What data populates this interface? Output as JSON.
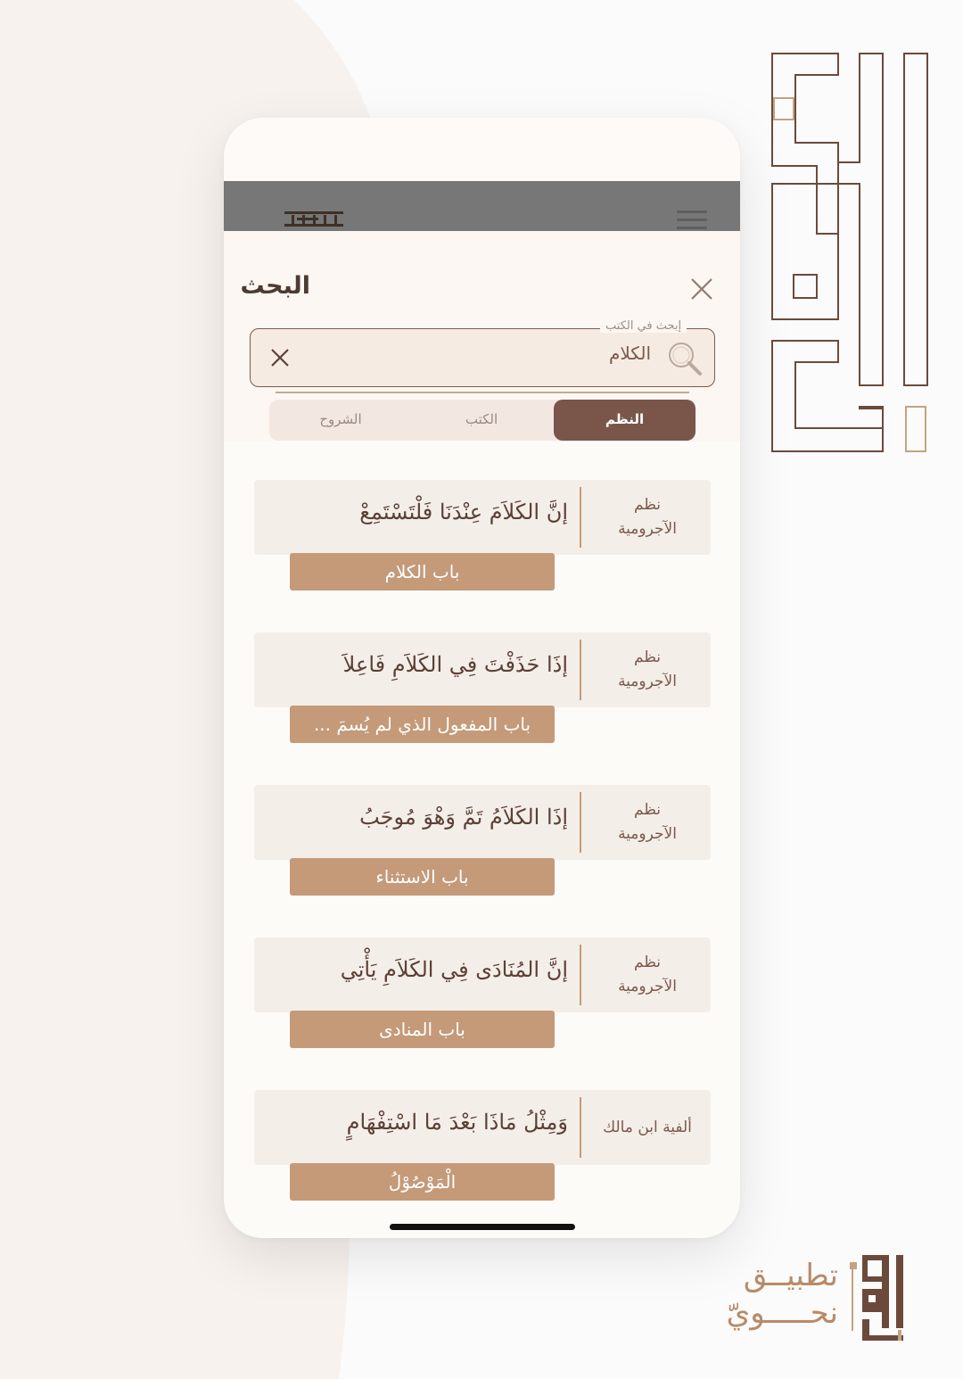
{
  "colors": {
    "brand_brown": "#7a554a",
    "chip_tan": "#c49a79",
    "appbar_gray": "#777777",
    "card_bg": "#f4eee9",
    "logo_outline": "#6b4a3c",
    "accent_gold": "#c6a27f"
  },
  "appbar": {
    "logo_text": "نحوي",
    "menu_icon": "hamburger-icon"
  },
  "search": {
    "title": "البحث",
    "close_icon": "close-icon",
    "field_label": "إبحث في الكتب",
    "field_value": "الكلام",
    "search_icon": "search-icon",
    "clear_icon": "clear-icon"
  },
  "tabs": [
    {
      "label": "النظم",
      "active": true
    },
    {
      "label": "الكتب",
      "active": false
    },
    {
      "label": "الشروح",
      "active": false
    }
  ],
  "results": [
    {
      "book_line1": "نظم",
      "book_line2": "الآجرومية",
      "verse": "إنَّ الكَلاَمَ عِنْدَنَا فَلْتَسْتَمِعْ",
      "chapter": "باب الكلام"
    },
    {
      "book_line1": "نظم",
      "book_line2": "الآجرومية",
      "verse": "إذَا حَذَفْتَ فِي الكَلاَمِ فَاعِلاَ",
      "chapter": "باب المفعول الذي لم يُسمَ ..."
    },
    {
      "book_line1": "نظم",
      "book_line2": "الآجرومية",
      "verse": "إذَا الكَلاَمُ تَمَّ وَهْوَ مُوجَبُ",
      "chapter": "باب الاستثناء"
    },
    {
      "book_line1": "نظم",
      "book_line2": "الآجرومية",
      "verse": "إنَّ المُنَادَى فِي الكَلاَمِ يَأْتِي",
      "chapter": "باب المنادى"
    },
    {
      "book_line1": "ألفية ابن مالك",
      "book_line2": "",
      "verse": "وَمِثْلُ مَاذَا بَعْدَ مَا اسْتِفْهَامٍ",
      "chapter": "الْمَوْصُوْلُ"
    }
  ],
  "branding": {
    "app_name_line1": "تطبيــق",
    "app_name_line2": "نحـــــويّ",
    "logo_icon": "nahwi-kufic-logo-icon"
  }
}
